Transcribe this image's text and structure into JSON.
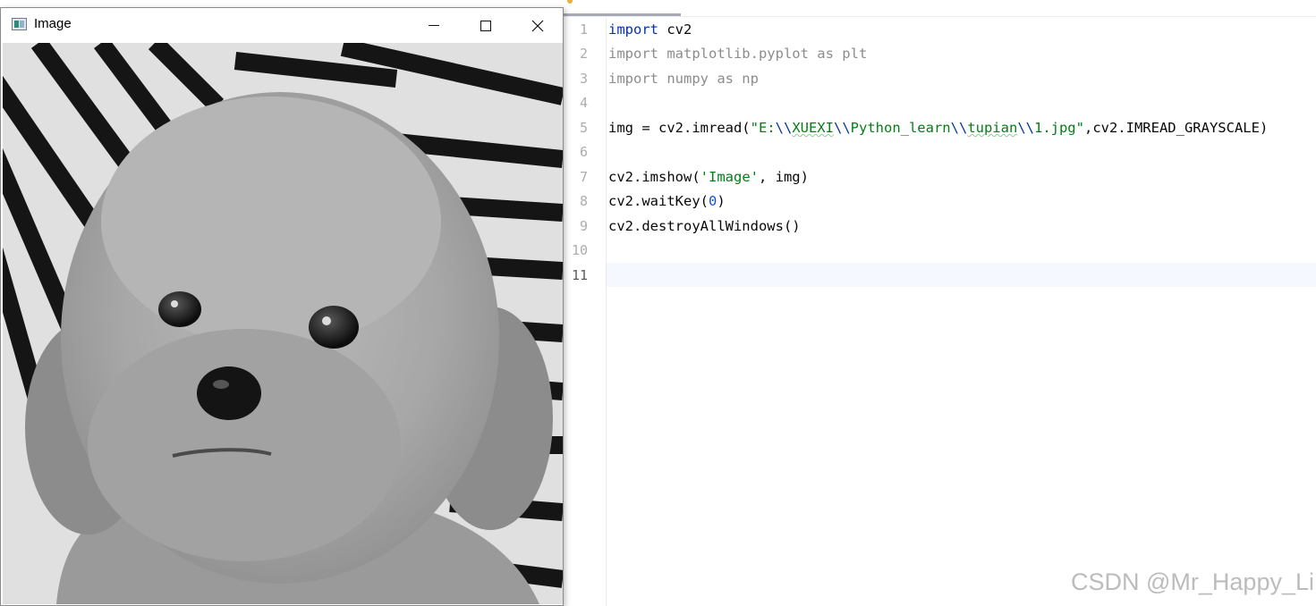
{
  "image_window": {
    "title": "Image",
    "icon": "opencv-window-icon",
    "controls": [
      "minimize-icon",
      "maximize-icon",
      "close-icon"
    ]
  },
  "editor": {
    "line_numbers": [
      "1",
      "2",
      "3",
      "4",
      "5",
      "6",
      "7",
      "8",
      "9",
      "10",
      "11"
    ],
    "current_line": "11",
    "lines": {
      "l1": {
        "kw": "import",
        "rest": " cv2"
      },
      "l2": {
        "text": "import matplotlib.pyplot as plt"
      },
      "l3": {
        "text": "import numpy as np"
      },
      "l5": {
        "p1": "img = cv2.imread(",
        "s1": "\"E:",
        "e1": "\\\\",
        "s2": "XUEXI",
        "e2": "\\\\",
        "s3": "Python_learn",
        "e3": "\\\\",
        "s4": "tupian",
        "e4": "\\\\",
        "s5": "1.jpg\"",
        "p2": ",cv2.IMREAD_GRAYSCALE)"
      },
      "l7": {
        "p1": "cv2.imshow(",
        "str": "'Image'",
        "p2": ", img)"
      },
      "l8": {
        "p1": "cv2.waitKey(",
        "num": "0",
        "p2": ")"
      },
      "l9": {
        "text": "cv2.destroyAllWindows()"
      }
    }
  },
  "watermark": "CSDN @Mr_Happy_Li",
  "colors": {
    "keyword": "#0033b3",
    "string": "#067d17",
    "number": "#1750eb",
    "dimmed": "#8c8c8c"
  }
}
